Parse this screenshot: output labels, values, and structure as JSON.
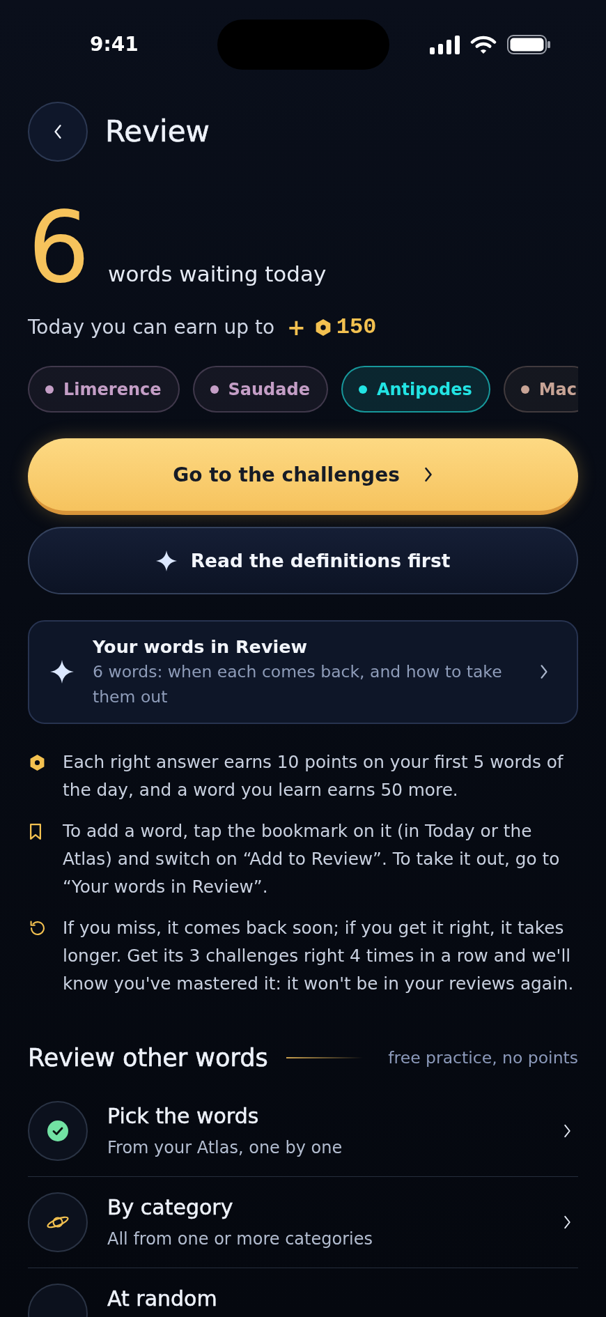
{
  "status_bar": {
    "time": "9:41"
  },
  "header": {
    "title": "Review"
  },
  "summary": {
    "count": "6",
    "label": "words waiting today",
    "earn_text": "Today you can earn up to",
    "earn_sign": "+",
    "earn_points": "150"
  },
  "chips": [
    {
      "label": "Limerence",
      "color": "#c49ec6",
      "selected": false
    },
    {
      "label": "Saudade",
      "color": "#c49ec6",
      "selected": false
    },
    {
      "label": "Antipodes",
      "color": "#22e4e4",
      "selected": true
    },
    {
      "label": "Mac",
      "color": "#c8a496",
      "selected": false
    }
  ],
  "primary_button": {
    "label": "Go to the challenges"
  },
  "secondary_button": {
    "label": "Read the definitions first"
  },
  "review_card": {
    "title": "Your words in Review",
    "subtitle": "6 words: when each comes back, and how to take them out"
  },
  "notes": [
    {
      "kind": "points",
      "text": "Each right answer earns 10 points on your first 5 words of the day, and a word you learn earns 50 more."
    },
    {
      "kind": "bookmark",
      "text": "To add a word, tap the bookmark on it (in Today or the Atlas) and switch on “Add to Review”. To take it out, go to “Your words in Review”."
    },
    {
      "kind": "repeat",
      "text": "If you miss, it comes back soon; if you get it right, it takes longer. Get its 3 challenges right 4 times in a row and we'll know you've mastered it: it won't be in your reviews again."
    }
  ],
  "other_section": {
    "title": "Review other words",
    "hint": "free practice, no points"
  },
  "options": [
    {
      "kind": "pick",
      "title": "Pick the words",
      "subtitle": "From your Atlas, one by one",
      "chevron": true
    },
    {
      "kind": "category",
      "title": "By category",
      "subtitle": "All from one or more categories",
      "chevron": true
    },
    {
      "kind": "random",
      "title": "At random"
    }
  ]
}
